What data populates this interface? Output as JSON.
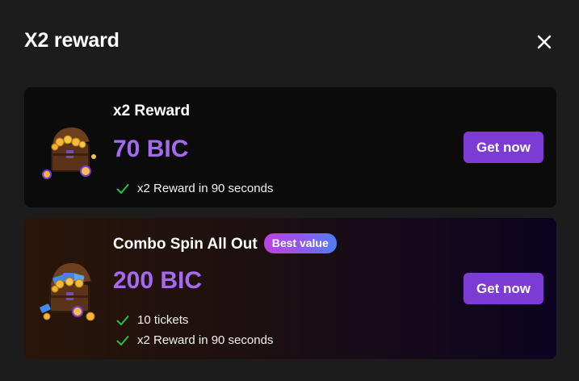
{
  "modal": {
    "title": "X2 reward"
  },
  "offers": [
    {
      "name": "x2 Reward",
      "price": "70 BIC",
      "features": [
        "x2 Reward in 90 seconds"
      ],
      "button_label": "Get now",
      "icon": "treasure-chest-icon"
    },
    {
      "name": "Combo Spin All Out",
      "badge": "Best value",
      "price": "200 BIC",
      "features": [
        "10 tickets",
        "x2 Reward in 90 seconds"
      ],
      "button_label": "Get now",
      "icon": "treasure-chest-tickets-icon"
    }
  ],
  "colors": {
    "background": "#1c1c1c",
    "card": "#0b0b0b",
    "price": "#a56af2",
    "button": "#7d3bd6",
    "check": "#27c24c"
  }
}
